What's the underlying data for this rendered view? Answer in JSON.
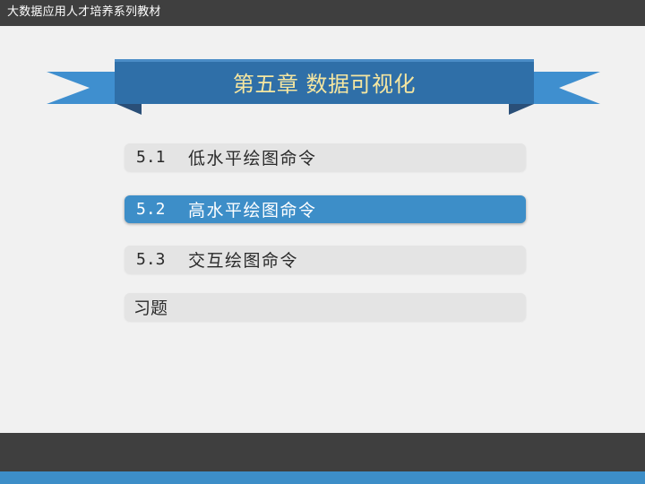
{
  "header": {
    "series_title": "大数据应用人才培养系列教材"
  },
  "chapter": {
    "title": "第五章 数据可视化"
  },
  "menu": {
    "items": [
      {
        "number": "5.1",
        "label": "低水平绘图命令"
      },
      {
        "number": "5.2",
        "label": "高水平绘图命令"
      },
      {
        "number": "5.3",
        "label": "交互绘图命令"
      },
      {
        "number": "",
        "label": "习题"
      }
    ],
    "active_index": 1
  },
  "colors": {
    "top_bar": "#3f3f3f",
    "background": "#f1f1f1",
    "ribbon_blue": "#3f8fcf",
    "ribbon_dark": "#2f6fa8",
    "active_item": "#3d8ec8",
    "title_text": "#f5e6a0",
    "footer_dark": "#3f3f3f",
    "footer_blue": "#3d8ec8"
  }
}
